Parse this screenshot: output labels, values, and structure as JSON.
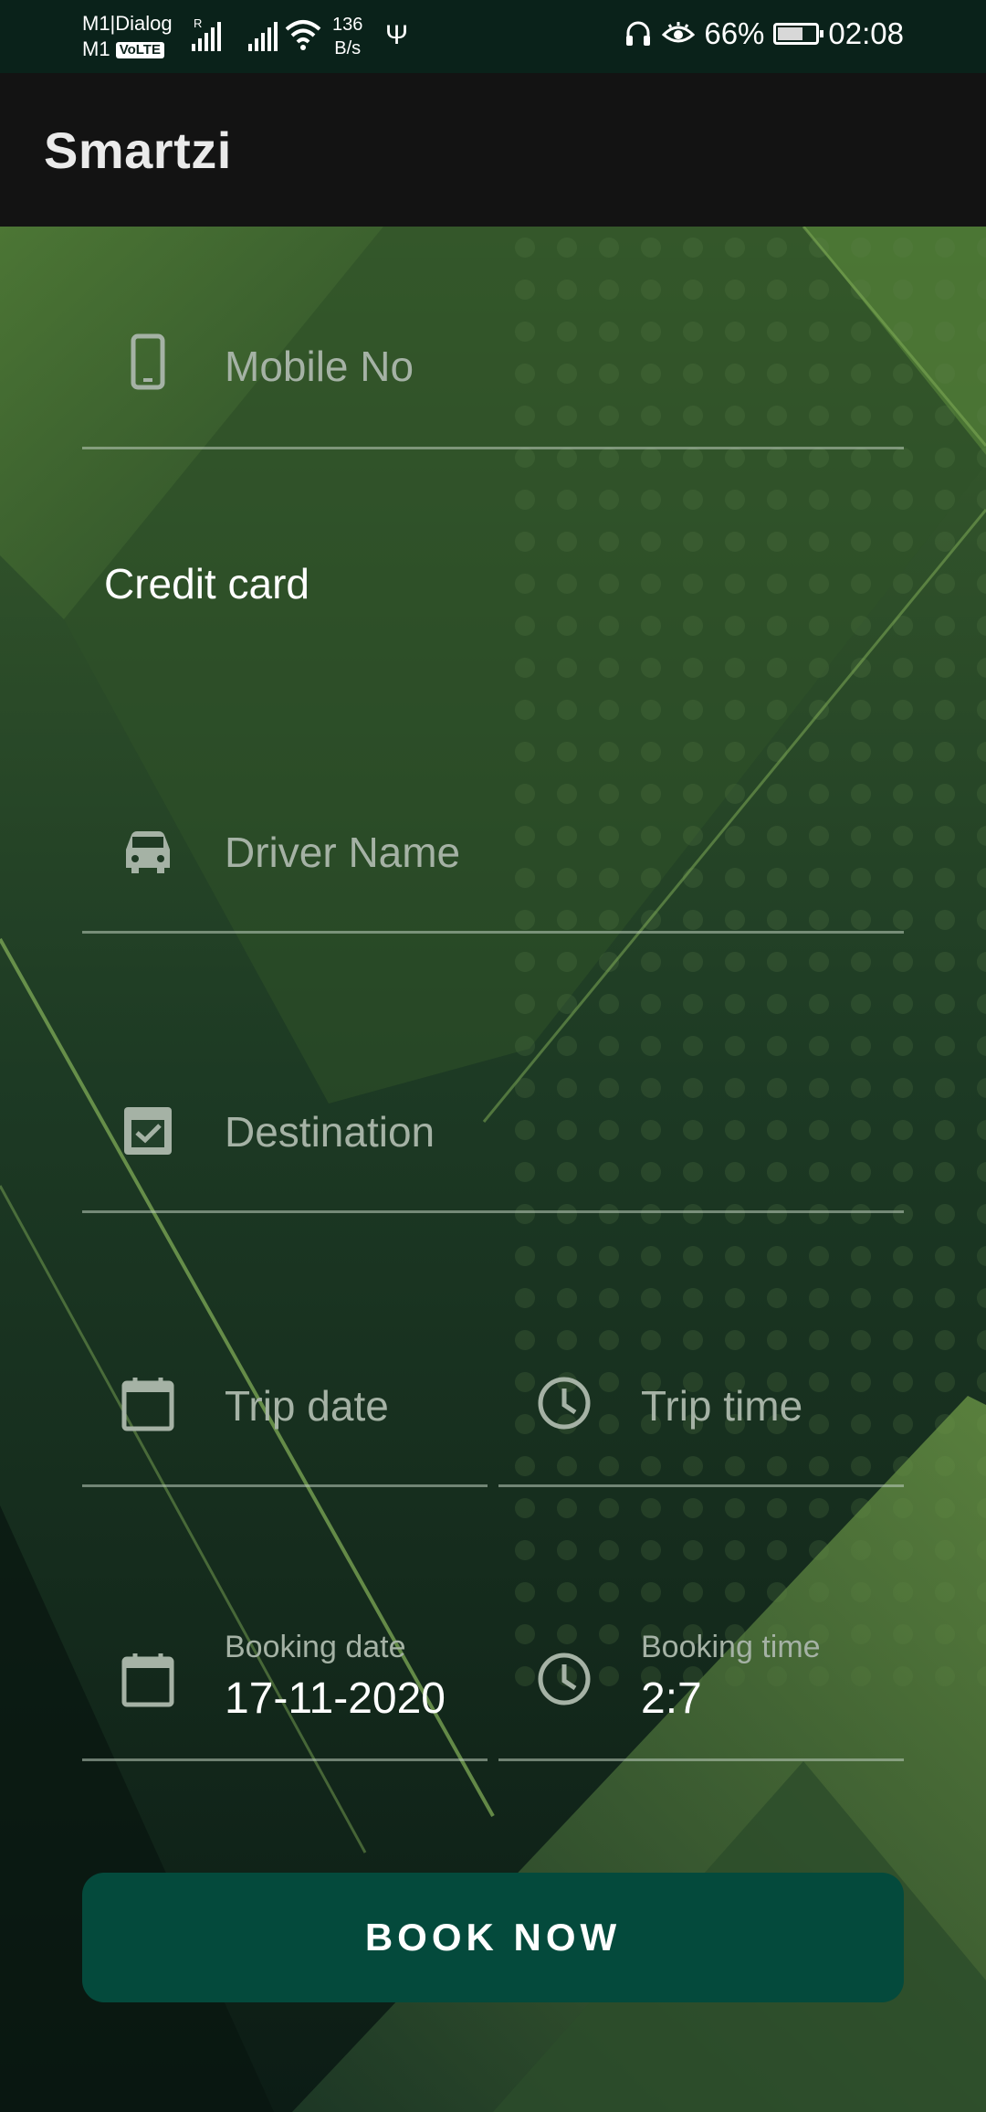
{
  "status_bar": {
    "carrier_1": "M1|Dialog",
    "carrier_2": "M1",
    "volte": "VoLTE",
    "roaming": "R",
    "speed_value": "136",
    "speed_unit": "B/s",
    "battery": "66%",
    "time": "02:08",
    "battery_level": 0.66
  },
  "app_bar": {
    "title": "Smartzi"
  },
  "form": {
    "mobile": {
      "placeholder": "Mobile No",
      "icon": "phone-icon"
    },
    "payment_label": "Credit card",
    "driver": {
      "placeholder": "Driver Name",
      "icon": "car-icon"
    },
    "destination": {
      "placeholder": "Destination",
      "icon": "checkbox-icon"
    },
    "trip_date": {
      "placeholder": "Trip date",
      "icon": "calendar-icon"
    },
    "trip_time": {
      "placeholder": "Trip time",
      "icon": "clock-icon"
    },
    "booking_date": {
      "label": "Booking date",
      "value": "17-11-2020",
      "icon": "calendar-icon"
    },
    "booking_time": {
      "label": "Booking time",
      "value": "2:7",
      "icon": "clock-icon"
    }
  },
  "book_button": {
    "label": "BOOK NOW"
  },
  "colors": {
    "status_bar": "#0a221a",
    "app_bar": "#131313",
    "button": "#044a3c",
    "background_green": "#3f6a2e",
    "field_hint": "#a5b2a5"
  }
}
